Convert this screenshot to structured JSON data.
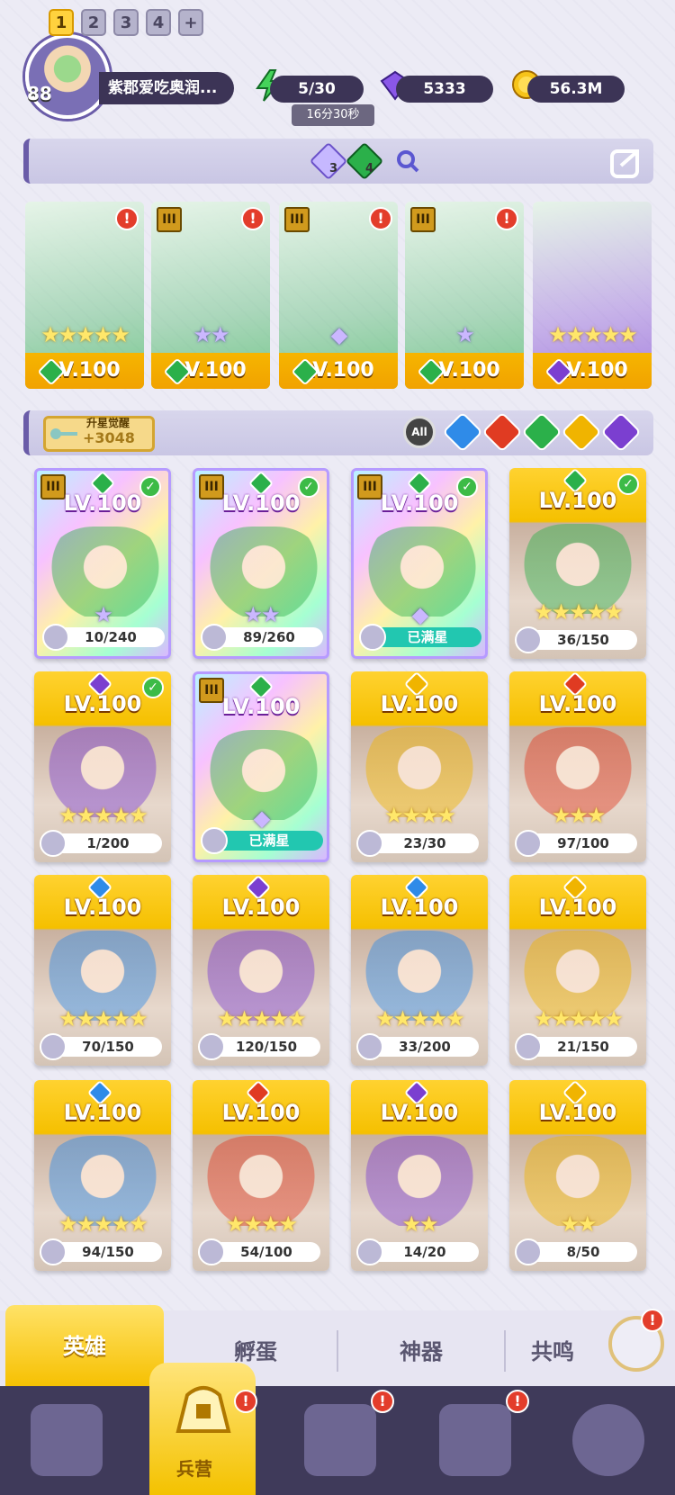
{
  "player": {
    "level": "88",
    "name": "紫郡爱吃奥润..."
  },
  "resources": {
    "energy": "5/30",
    "energy_timer": "16分30秒",
    "gems": "5333",
    "gold": "56.3M"
  },
  "team_tabs": [
    "1",
    "2",
    "3",
    "4",
    "+"
  ],
  "team_counts": {
    "purple": "3",
    "green": "4"
  },
  "team": [
    {
      "level": "LV.100",
      "stars": "★★★★★",
      "star_type": "gold",
      "element": "green"
    },
    {
      "level": "LV.100",
      "stars": "★★",
      "star_type": "purple",
      "element": "green"
    },
    {
      "level": "LV.100",
      "stars": "◆",
      "star_type": "purple",
      "element": "green"
    },
    {
      "level": "LV.100",
      "stars": "★",
      "star_type": "purple",
      "element": "green"
    },
    {
      "level": "LV.100",
      "stars": "★★★★★",
      "star_type": "gold",
      "element": "purple"
    }
  ],
  "awaken": {
    "label": "升星觉醒",
    "value": "+3048"
  },
  "filters": {
    "all": "All"
  },
  "heroes": [
    {
      "level": "LV.100",
      "progress": "10/240",
      "stars": "★",
      "type": "holo",
      "element": "green"
    },
    {
      "level": "LV.100",
      "progress": "89/260",
      "stars": "★★",
      "type": "holo",
      "element": "green"
    },
    {
      "level": "LV.100",
      "progress": "已满星",
      "stars": "◆",
      "type": "holo",
      "element": "green"
    },
    {
      "level": "LV.100",
      "progress": "36/150",
      "stars": "★★★★★",
      "type": "gold",
      "element": "green"
    },
    {
      "level": "LV.100",
      "progress": "1/200",
      "stars": "★★★★★",
      "type": "gold",
      "element": "purple"
    },
    {
      "level": "LV.100",
      "progress": "已满星",
      "stars": "◆",
      "type": "holo",
      "element": "green"
    },
    {
      "level": "LV.100",
      "progress": "23/30",
      "stars": "★★★★",
      "type": "gold",
      "element": "yellow"
    },
    {
      "level": "LV.100",
      "progress": "97/100",
      "stars": "★★★",
      "type": "gold",
      "element": "red"
    },
    {
      "level": "LV.100",
      "progress": "70/150",
      "stars": "★★★★★",
      "type": "gold",
      "element": "blue"
    },
    {
      "level": "LV.100",
      "progress": "120/150",
      "stars": "★★★★★",
      "type": "gold",
      "element": "purple"
    },
    {
      "level": "LV.100",
      "progress": "33/200",
      "stars": "★★★★★",
      "type": "gold",
      "element": "blue"
    },
    {
      "level": "LV.100",
      "progress": "21/150",
      "stars": "★★★★★",
      "type": "gold",
      "element": "yellow"
    },
    {
      "level": "LV.100",
      "progress": "94/150",
      "stars": "★★★★★",
      "type": "gold",
      "element": "blue"
    },
    {
      "level": "LV.100",
      "progress": "54/100",
      "stars": "★★★★",
      "type": "gold",
      "element": "red"
    },
    {
      "level": "LV.100",
      "progress": "14/20",
      "stars": "★★",
      "type": "gold",
      "element": "purple"
    },
    {
      "level": "LV.100",
      "progress": "8/50",
      "stars": "★★",
      "type": "gold",
      "element": "yellow"
    }
  ],
  "tabs": [
    "英雄",
    "孵蛋",
    "神器",
    "共鸣"
  ],
  "nav": {
    "active_label": "兵营"
  },
  "colors": {
    "green": "#2bb04a",
    "purple": "#7b3fd0",
    "blue": "#2f8be8",
    "red": "#e03b22",
    "yellow": "#f0b400"
  }
}
